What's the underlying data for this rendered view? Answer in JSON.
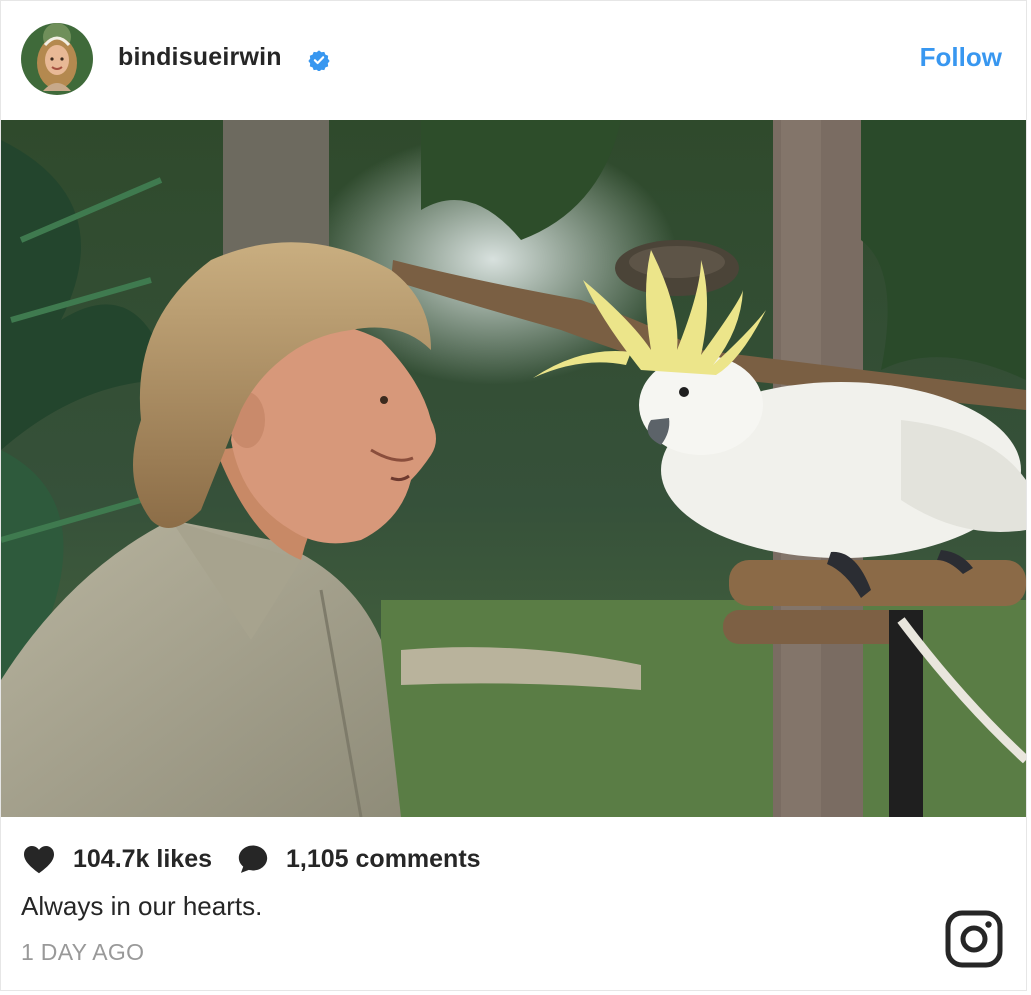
{
  "header": {
    "username": "bindisueirwin",
    "verified": true,
    "follow_label": "Follow"
  },
  "post": {
    "likes_label": "104.7k likes",
    "comments_label": "1,105 comments",
    "caption": "Always in our hearts.",
    "timestamp": "1 DAY AGO"
  },
  "icons": {
    "like": "heart-icon",
    "comment": "comment-bubble-icon",
    "verified": "verified-badge-icon",
    "brand": "instagram-logo-icon"
  },
  "colors": {
    "link_blue": "#3897f0",
    "text_dark": "#262626",
    "text_muted": "#999999",
    "border": "#e6e6e6"
  }
}
